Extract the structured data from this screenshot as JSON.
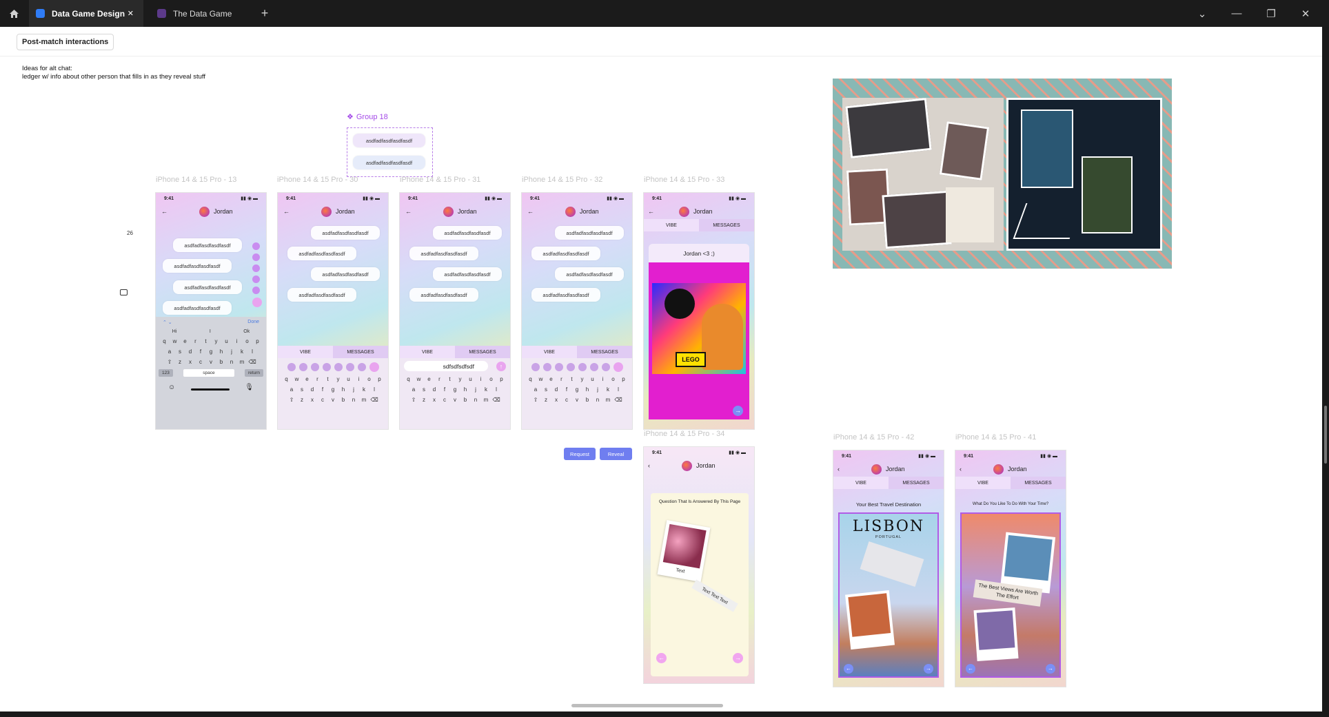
{
  "tabs": [
    {
      "label": "Data Game Design",
      "close": "✕"
    },
    {
      "label": "The Data Game"
    }
  ],
  "titlebar_icons": {
    "home": "home-icon",
    "add": "+",
    "chevron": "⌄",
    "minimize": "—",
    "restore": "❐",
    "close": "✕"
  },
  "section_chip": "Post-match interactions",
  "notes": [
    "Ideas for alt chat:",
    "ledger w/ info about other person that fills in as they reveal stuff"
  ],
  "group": {
    "label": "Group 18",
    "bubbles": [
      "asdfadfasdfasdfasdf",
      "asdfadfasdfasdfasdf"
    ]
  },
  "side_counter": "26",
  "frames": {
    "f13": "iPhone 14 & 15 Pro - 13",
    "f30": "iPhone 14 & 15 Pro - 30",
    "f31": "iPhone 14 & 15 Pro - 31",
    "f32": "iPhone 14 & 15 Pro - 32",
    "f33": "iPhone 14 & 15 Pro - 33",
    "f34": "iPhone 14 & 15 Pro - 34",
    "f42": "iPhone 14 & 15 Pro - 42",
    "f41": "iPhone 14 & 15 Pro - 41"
  },
  "phone": {
    "time": "9:41",
    "name": "Jordan",
    "bubble": "asdfadfasdfasdfasdf",
    "vibe": "VIBE",
    "messages": "MESSAGES",
    "done": "Done",
    "suggest": [
      "Hi",
      "I",
      "Ok"
    ],
    "row1": [
      "q",
      "w",
      "e",
      "r",
      "t",
      "y",
      "u",
      "i",
      "o",
      "p"
    ],
    "row2": [
      "a",
      "s",
      "d",
      "f",
      "g",
      "h",
      "j",
      "k",
      "l"
    ],
    "row3": [
      "z",
      "x",
      "c",
      "v",
      "b",
      "n",
      "m"
    ],
    "k123": "123",
    "space": "space",
    "return": "return",
    "typed": "sdfsdfsdfsdf"
  },
  "f33_card": "Jordan <3 ;)",
  "f33_lego": "LEGO",
  "f34_title": "Question That Is Answered By This Page",
  "f34_text1": "Text",
  "f34_text2": "Text Text Text",
  "f42_title": "Your Best Travel Destination",
  "f42_city": "LISBON",
  "f42_country": "PORTUGAL",
  "f41_title": "What Do You Like To Do With Your Time?",
  "f41_caption": "The Best Views Are Worth The Effort",
  "buttons": {
    "request": "Request",
    "reveal": "Reveal"
  },
  "colors": {
    "accent": "#6f7ef0",
    "magenta": "#e21fcf",
    "purple": "#b15be6"
  }
}
